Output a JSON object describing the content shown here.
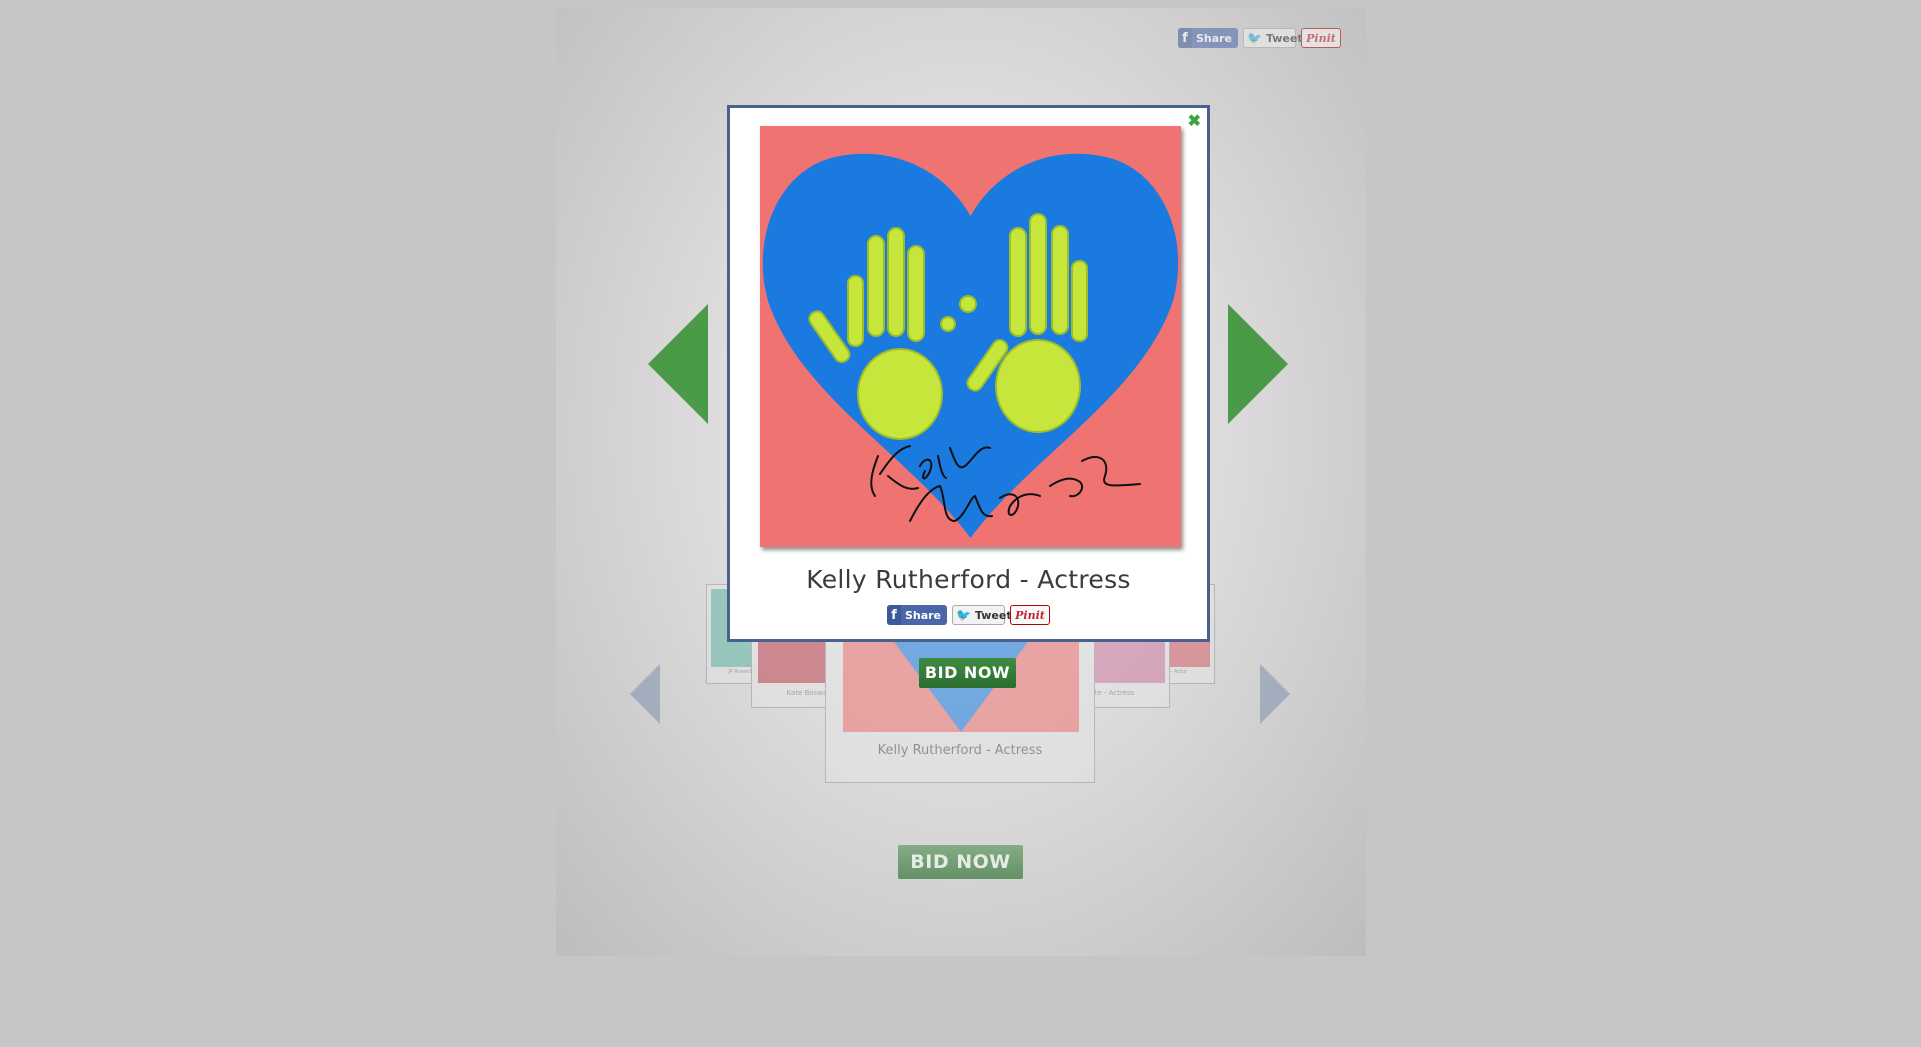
{
  "social": {
    "share_label": "Share",
    "tweet_label": "Tweet",
    "pin_label": "Pinit",
    "fb_glyph": "f",
    "tw_glyph": "🐦"
  },
  "carousel": {
    "cards": [
      {
        "caption": "JP Rosenbaum"
      },
      {
        "caption": "Kate Bosworth"
      },
      {
        "caption": "Kelly Rutherford - Actress"
      },
      {
        "caption": "...ate - Actress"
      },
      {
        "caption": "...ne - Actor"
      }
    ]
  },
  "bid_label": "BID NOW",
  "modal": {
    "close_glyph": "✖",
    "title": "Kelly Rutherford - Actress",
    "signature": "Kelly Rutherford"
  },
  "colors": {
    "art_background": "#ef7371",
    "heart": "#1a7ae0",
    "hands": "#c6e63c",
    "arrow_green": "#4a9a48",
    "modal_border": "#48618f"
  }
}
